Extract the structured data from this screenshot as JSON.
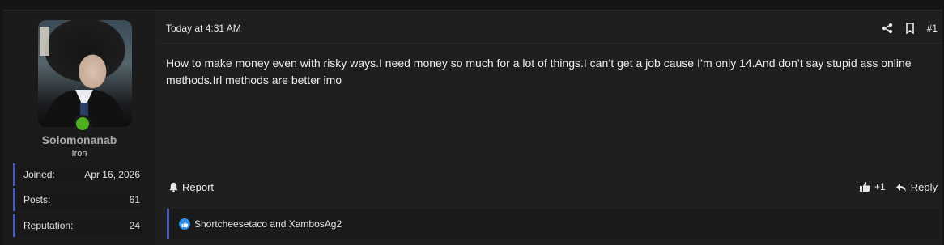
{
  "user": {
    "username": "Solomonanab",
    "rank": "Iron",
    "avatar_icon": "avatar-image",
    "online_color": "#4caf1f",
    "stats": [
      {
        "label": "Joined:",
        "value": "Apr 16, 2026"
      },
      {
        "label": "Posts:",
        "value": "61"
      },
      {
        "label": "Reputation:",
        "value": "24"
      }
    ]
  },
  "post": {
    "timestamp": "Today at 4:31 AM",
    "number": "#1",
    "body": "How to make money even with risky ways.I need money so much for a lot of things.I can’t get a job cause I’m only 14.And don’t say stupid ass online methods.Irl methods are better imo",
    "icons": [
      "share-icon",
      "bookmark-icon"
    ]
  },
  "actions": {
    "report_label": "Report",
    "like_label": "+1",
    "reply_label": "Reply"
  },
  "reactions": {
    "text": "Shortcheesetaco and XambosAg2",
    "icon": "like-icon",
    "accent": "#2f8fe8"
  },
  "colors": {
    "accent_bar": "#4a5ab7",
    "background": "#1f1f1f"
  }
}
